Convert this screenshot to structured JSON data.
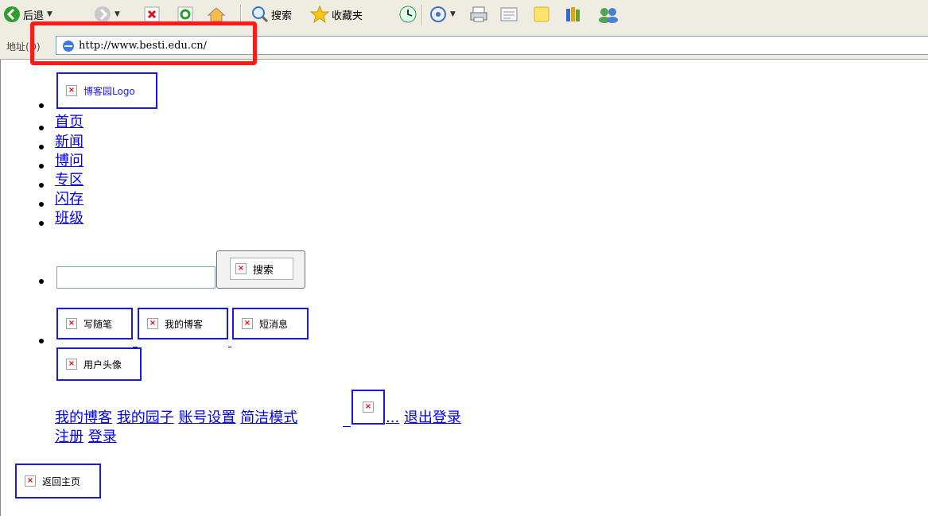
{
  "toolbar": {
    "back_label": "后退",
    "search_label": "搜索",
    "favorites_label": "收藏夹"
  },
  "address": {
    "label": "地址(D)",
    "url": "http://www.besti.edu.cn/"
  },
  "page": {
    "logo_alt": "博客园Logo",
    "nav": [
      "首页",
      "新闻",
      "博问",
      "专区",
      "闪存",
      "班级"
    ],
    "search_button_alt": "搜索",
    "action_buttons": [
      "写随笔",
      "我的博客",
      "短消息"
    ],
    "avatar_alt": "用户头像",
    "user_links": [
      "我的博客",
      "我的园子",
      "账号设置",
      "简洁模式"
    ],
    "ellipsis_text": "...",
    "logout_label": "退出登录",
    "register_label": "注册",
    "login_label": "登录",
    "back_home_alt": "返回主页"
  },
  "colors": {
    "link": "#0000ee",
    "image_border": "#1a1adf",
    "highlight": "#ff1a1a"
  }
}
